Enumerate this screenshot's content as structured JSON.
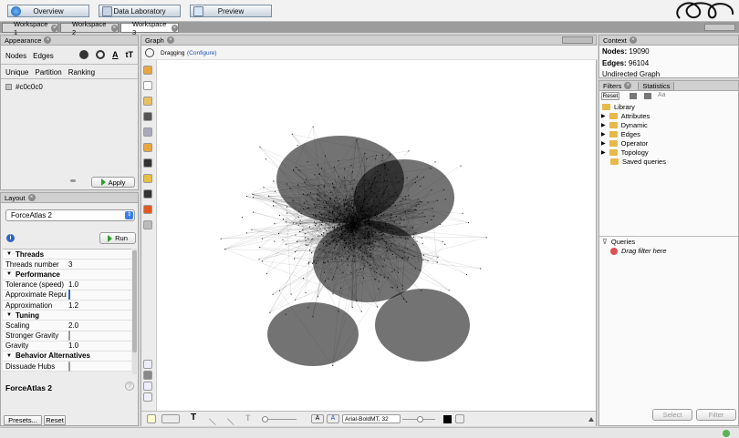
{
  "colors": {
    "folder": "#e7b94a",
    "checkbox_on": "#3b7fe6",
    "apply_green": "#2aa02a"
  },
  "topbar": {
    "overview": "Overview",
    "data_lab": "Data Laboratory",
    "preview": "Preview"
  },
  "workspaces": [
    "Workspace 1",
    "Workspace 2",
    "Workspace 3"
  ],
  "appearance": {
    "title": "Appearance",
    "tabs": [
      "Nodes",
      "Edges"
    ],
    "subtabs": [
      "Unique",
      "Partition",
      "Ranking"
    ],
    "color_value": "#c0c0c0",
    "apply": "Apply"
  },
  "layout": {
    "title": "Layout",
    "algorithm": "ForceAtlas 2",
    "run": "Run",
    "rows": [
      {
        "type": "section",
        "label": "Threads"
      },
      {
        "type": "prop",
        "label": "Threads number",
        "value": "3"
      },
      {
        "type": "section",
        "label": "Performance"
      },
      {
        "type": "prop",
        "label": "Tolerance (speed)",
        "value": "1.0"
      },
      {
        "type": "check",
        "label": "Approximate Repul",
        "checked": true
      },
      {
        "type": "prop",
        "label": "Approximation",
        "value": "1.2"
      },
      {
        "type": "section",
        "label": "Tuning"
      },
      {
        "type": "prop",
        "label": "Scaling",
        "value": "2.0"
      },
      {
        "type": "check",
        "label": "Stronger Gravity",
        "checked": false
      },
      {
        "type": "prop",
        "label": "Gravity",
        "value": "1.0"
      },
      {
        "type": "section",
        "label": "Behavior Alternatives"
      },
      {
        "type": "check",
        "label": "Dissuade Hubs",
        "checked": false
      }
    ],
    "desc_title": "ForceAtlas 2",
    "presets": "Presets...",
    "reset": "Reset"
  },
  "graph": {
    "title": "Graph",
    "mode": "Dragging",
    "configure": "(Configure)",
    "font": "Arial-BoldMT, 32"
  },
  "context": {
    "title": "Context",
    "nodes_label": "Nodes:",
    "nodes": "19090",
    "edges_label": "Edges:",
    "edges": "96104",
    "type": "Undirected Graph"
  },
  "filters": {
    "tab1": "Filters",
    "tab2": "Statistics",
    "reset": "Reset",
    "library": "Library",
    "items": [
      "Attributes",
      "Dynamic",
      "Edges",
      "Operator",
      "Topology",
      "Saved queries"
    ],
    "queries": "Queries",
    "drag": "Drag filter here",
    "select": "Select",
    "filter": "Filter"
  }
}
